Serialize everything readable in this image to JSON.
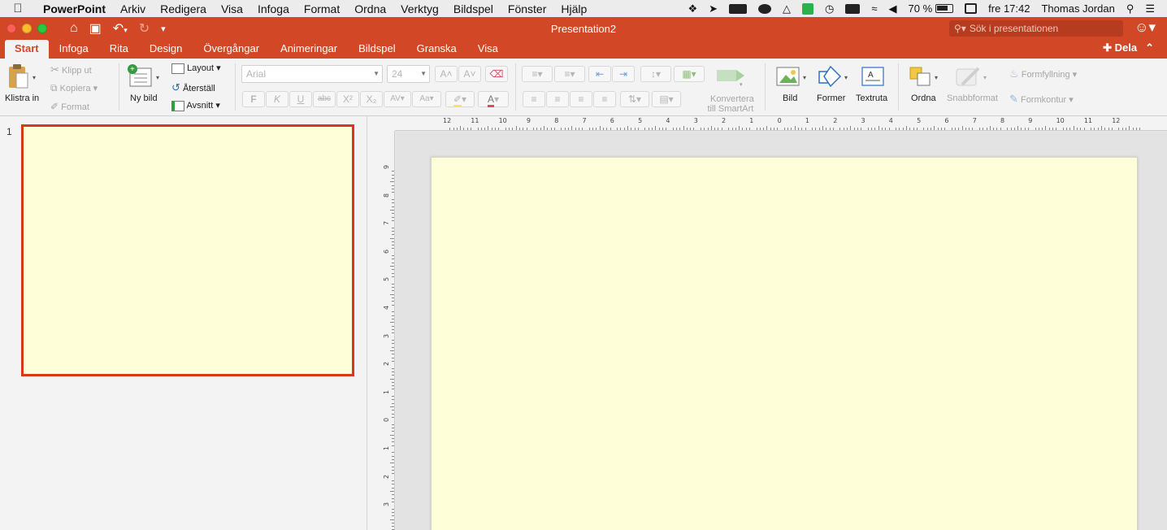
{
  "menubar": {
    "app": "PowerPoint",
    "items": [
      "Arkiv",
      "Redigera",
      "Visa",
      "Infoga",
      "Format",
      "Ordna",
      "Verktyg",
      "Bildspel",
      "Fönster",
      "Hjälp"
    ],
    "battery": "70 %",
    "clock": "fre 17:42",
    "user": "Thomas Jordan"
  },
  "titlebar": {
    "document_title": "Presentation2",
    "search_placeholder": "Sök i presentationen"
  },
  "tabs": [
    "Start",
    "Infoga",
    "Rita",
    "Design",
    "Övergångar",
    "Animeringar",
    "Bildspel",
    "Granska",
    "Visa"
  ],
  "share_label": "Dela",
  "ribbon": {
    "paste": "Klistra in",
    "cut": "Klipp ut",
    "copy": "Kopiera",
    "format_painter": "Format",
    "new_slide": "Ny bild",
    "layout": "Layout",
    "reset": "Återställ",
    "section": "Avsnitt",
    "font_name": "Arial",
    "font_size": "24",
    "convert_smartart_line1": "Konvertera",
    "convert_smartart_line2": "till SmartArt",
    "picture": "Bild",
    "shapes": "Former",
    "textbox": "Textruta",
    "arrange": "Ordna",
    "quick_styles": "Snabbformat",
    "shape_fill": "Formfyllning",
    "shape_outline": "Formkontur"
  },
  "slides": [
    {
      "number": "1"
    }
  ],
  "ruler": {
    "top_labels": [
      "12",
      "11",
      "10",
      "9",
      "8",
      "7",
      "6",
      "5",
      "4",
      "3",
      "2",
      "1",
      "0",
      "1",
      "2",
      "3",
      "4",
      "5",
      "6",
      "7",
      "8",
      "9",
      "10",
      "11",
      "12"
    ],
    "left_labels": [
      "9",
      "8",
      "7",
      "6",
      "5",
      "4",
      "3",
      "2",
      "1",
      "0",
      "1",
      "2",
      "3"
    ]
  },
  "colors": {
    "accent": "#d24726",
    "slide_background": "#fefed9",
    "selection": "#d9371b"
  }
}
